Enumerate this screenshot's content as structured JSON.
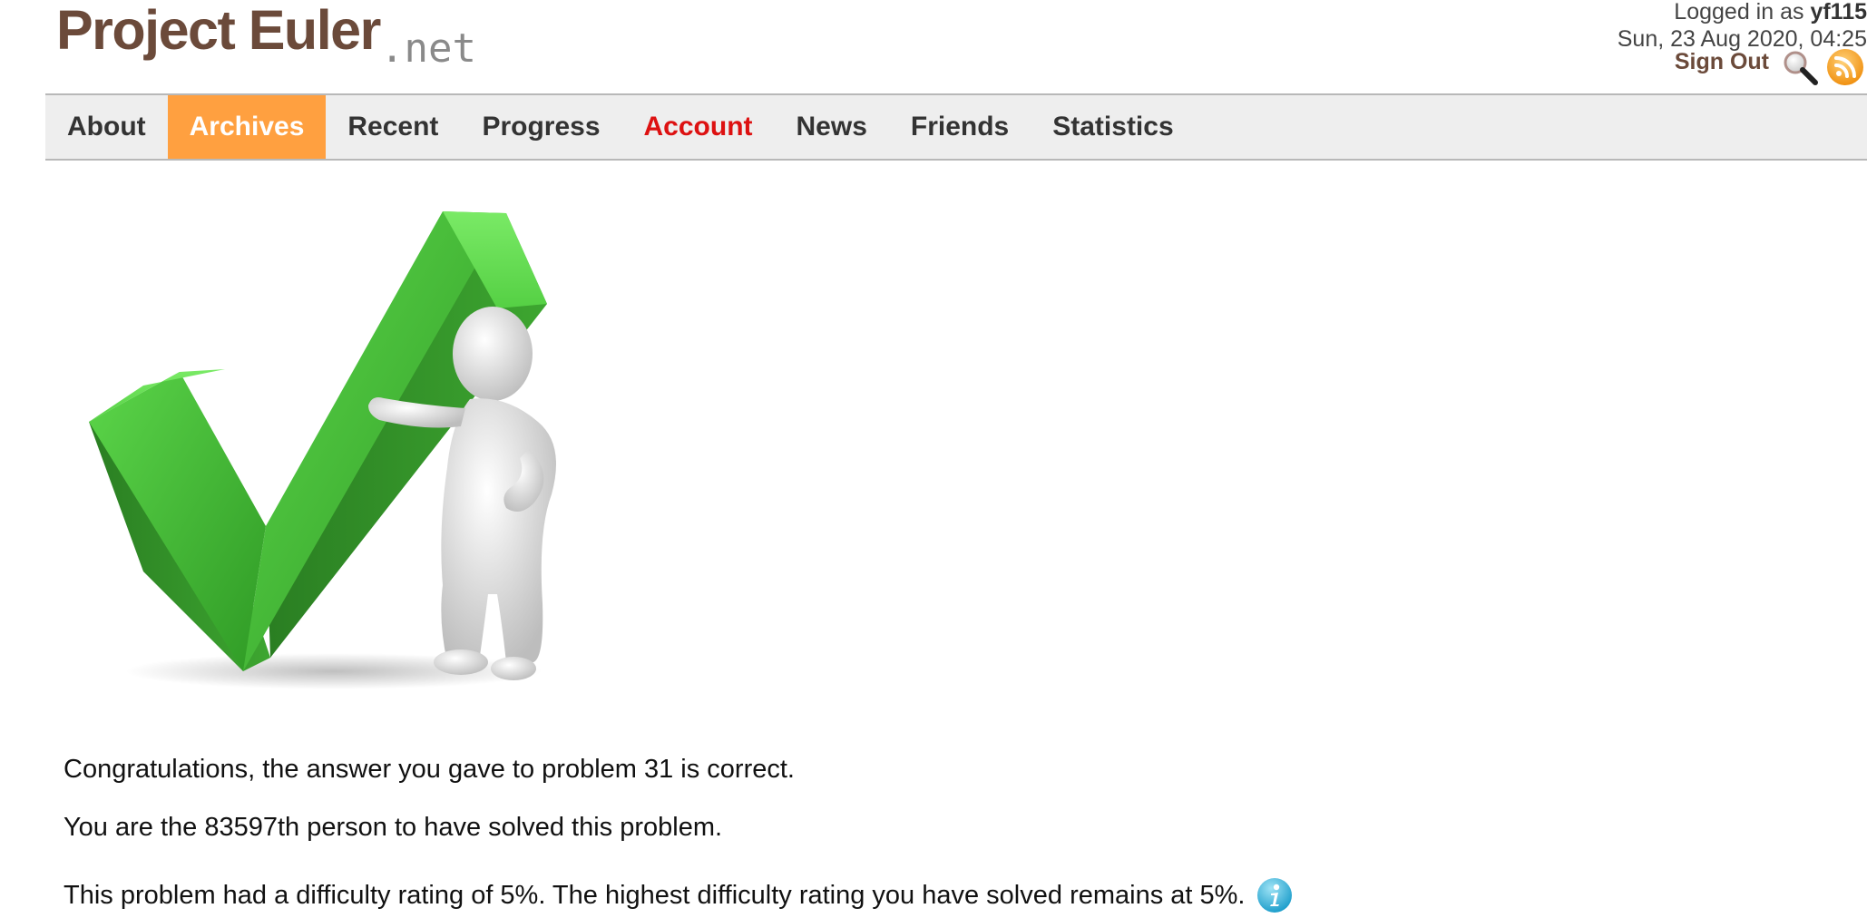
{
  "logo": {
    "main": "Project Euler",
    "sub": ".net"
  },
  "user": {
    "logged_in_prefix": "Logged in as",
    "username": "yf115",
    "datetime": "Sun, 23 Aug 2020, 04:25",
    "sign_out": "Sign Out"
  },
  "icons": {
    "search": "search-icon",
    "rss": "rss-icon",
    "info": "info-icon"
  },
  "nav": {
    "items": [
      {
        "label": "About"
      },
      {
        "label": "Archives"
      },
      {
        "label": "Recent"
      },
      {
        "label": "Progress"
      },
      {
        "label": "Account"
      },
      {
        "label": "News"
      },
      {
        "label": "Friends"
      },
      {
        "label": "Statistics"
      }
    ],
    "active": "Archives",
    "highlight": "Account"
  },
  "colors": {
    "active_tab": "#ffa040",
    "account_link": "#dd1111",
    "logo": "#6b4a3a",
    "check_green": "#4cc23a"
  },
  "message": {
    "line1": "Congratulations, the answer you gave to problem 31 is correct.",
    "line2": "You are the 83597th person to have solved this problem.",
    "line3": "This problem had a difficulty rating of 5%. The highest difficulty rating you have solved remains at 5%."
  }
}
